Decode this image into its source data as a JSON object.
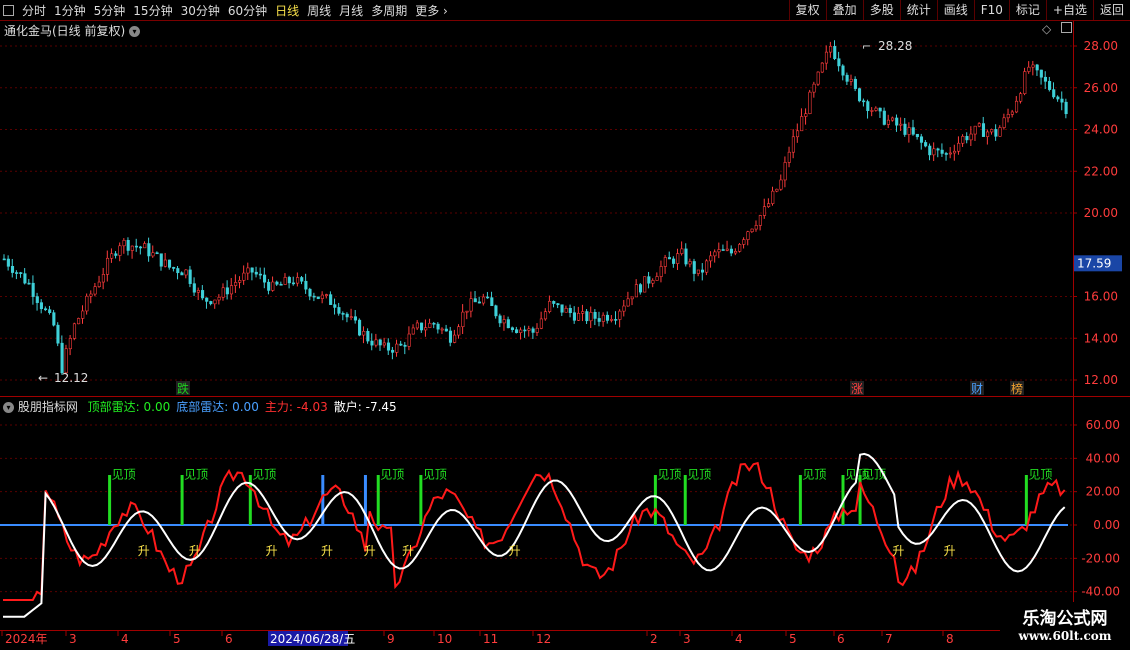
{
  "toolbar": {
    "periods": [
      "分时",
      "1分钟",
      "5分钟",
      "15分钟",
      "30分钟",
      "60分钟",
      "日线",
      "周线",
      "月线",
      "多周期",
      "更多"
    ],
    "active": "日线",
    "more_chevron": "›",
    "right_buttons": [
      "复权",
      "叠加",
      "多股",
      "统计",
      "画线",
      "F10",
      "标记",
      "+自选",
      "返回"
    ]
  },
  "main_panel": {
    "title": "通化金马(日线 前复权)",
    "y_ticks": [
      "28.00",
      "26.00",
      "24.00",
      "22.00",
      "20.00",
      "16.00",
      "14.00",
      "12.00"
    ],
    "current_price": "17.59",
    "high_label": "28.28",
    "low_label": "12.12",
    "markers": [
      {
        "text": "跌",
        "color": "#1fd11f"
      },
      {
        "text": "涨",
        "color": "#ff4040"
      },
      {
        "text": "财",
        "color": "#4aa0ff"
      },
      {
        "text": "榜",
        "color": "#f0a030"
      }
    ]
  },
  "indicator_panel": {
    "name": "股朋指标网",
    "fields": [
      {
        "label": "顶部雷达:",
        "value": "0.00",
        "color": "#22ee22"
      },
      {
        "label": "底部雷达:",
        "value": "0.00",
        "color": "#4aa0ff"
      },
      {
        "label": "主力:",
        "value": "-4.03",
        "color": "#ff3030"
      },
      {
        "label": "散户:",
        "value": "-7.45",
        "color": "#ffffff"
      }
    ],
    "y_ticks": [
      "60.00",
      "40.00",
      "20.00",
      "0.00",
      "-20.00",
      "-40.00"
    ],
    "top_label": "见顶",
    "bottom_label": "升"
  },
  "x_axis": {
    "labels": [
      "2024年",
      "3",
      "4",
      "5",
      "6",
      "9",
      "10",
      "11",
      "12",
      "2",
      "3",
      "4",
      "5",
      "6",
      "7",
      "8"
    ],
    "highlight": "2024/06/28/五"
  },
  "watermark": {
    "line1": "乐淘公式网",
    "line2": "www.60lt.com"
  },
  "colors": {
    "up": "#ff3c3c",
    "down": "#3fd0d8",
    "grid": "#5a0000",
    "axis": "#a00000",
    "main_force": "#ff1a1a",
    "retail": "#ffffff",
    "top_radar": "#22dd22",
    "bottom_radar": "#3a8cff",
    "zero_line": "#3a8cff",
    "label_yellow": "#f8e14a"
  }
}
